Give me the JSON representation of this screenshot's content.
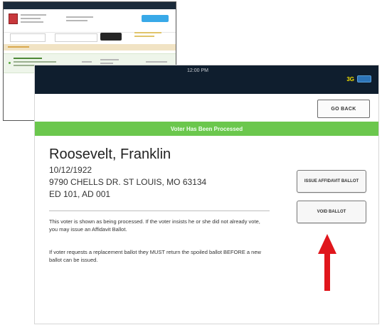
{
  "status_bar": {
    "time": "12:00 PM",
    "signal": "3G"
  },
  "nav": {
    "go_back": "GO BACK"
  },
  "banner": {
    "text": "Voter Has Been Processed",
    "color": "#6bc74d"
  },
  "voter": {
    "name": "Roosevelt, Franklin",
    "dob": "10/12/1922",
    "address": "9790 CHELLS DR. ST LOUIS, MO 63134",
    "district": "ED 101, AD 001"
  },
  "messages": {
    "processed": "This voter is shown as being processed. If the voter insists he or she did not already vote, you may issue an Affidavit Ballot.",
    "replacement": "If voter requests a replacement ballot they MUST return the spoiled ballot BEFORE a new ballot can be issued."
  },
  "actions": {
    "issue_affidavit": "ISSUE AFFIDAVIT BALLOT",
    "void_ballot": "VOID BALLOT"
  },
  "annotation": {
    "arrow_color": "#e0161c"
  },
  "icons": [
    "battery-icon",
    "red-arrow-icon"
  ]
}
